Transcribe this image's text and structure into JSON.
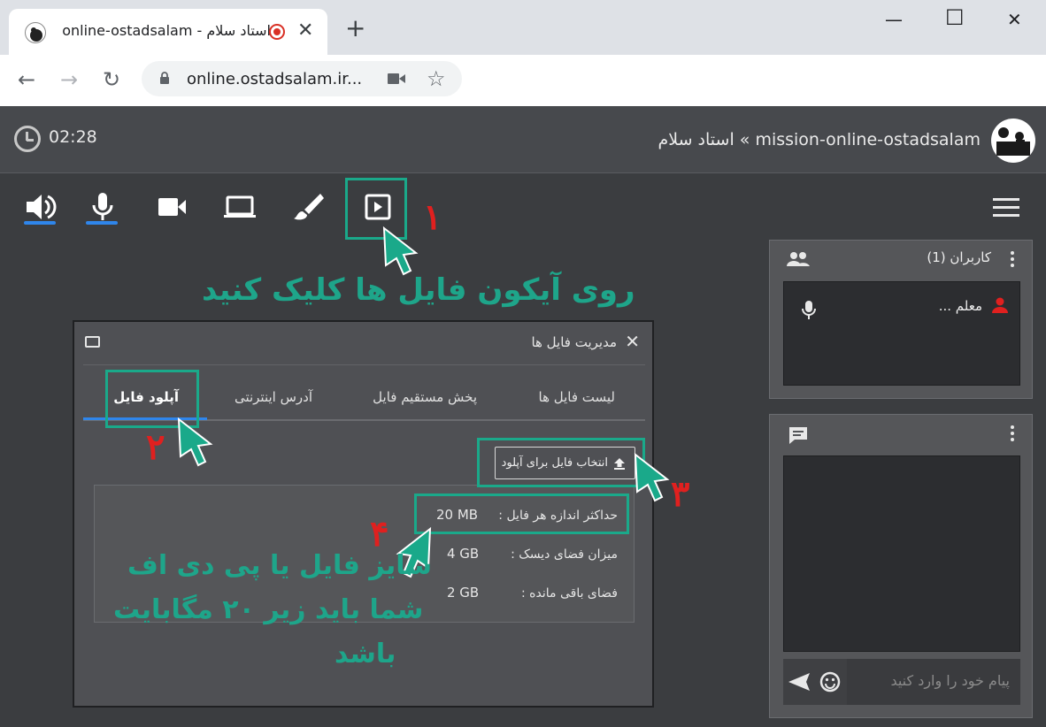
{
  "browser": {
    "tab_title": "استاد سلام - online-ostadsalam",
    "tab_close": "✕",
    "new_tab": "+",
    "minimize": "—",
    "maximize": "☐",
    "close": "✕",
    "back": "←",
    "forward": "→",
    "reload": "↻",
    "url": "online.ostadsalam.ir...",
    "star": "☆"
  },
  "header": {
    "timer": "02:28",
    "room_title": "استاد سلام « mission-online-ostadsalam"
  },
  "toolbar": {
    "icons": [
      "speaker-icon",
      "microphone-icon",
      "camera-icon",
      "screen-share-icon",
      "whiteboard-brush-icon",
      "file-presentation-icon",
      "menu-icon"
    ]
  },
  "annotations": {
    "step1_num": "۱",
    "step1_text": "روی آیکون فایل ها کلیک کنید",
    "step2_num": "۲",
    "step3_num": "۳",
    "step4_num": "۴",
    "step4_line1": "سایز فایل یا پی دی اف",
    "step4_line2": "شما باید زیر ۲۰ مگابایت",
    "step4_line3": "باشد",
    "color": "#1ea58a",
    "number_color": "#e0201f"
  },
  "users_panel": {
    "title": "کاربران (1)",
    "user_name": "معلم ..."
  },
  "chat_panel": {
    "input_placeholder": "پیام خود را وارد کنید"
  },
  "file_manager": {
    "title": "مدیریت فایل ها",
    "tabs": [
      "لیست فایل ها",
      "پخش مستقیم فایل",
      "آدرس اینترنتی",
      "آپلود فایل"
    ],
    "active_tab": "آپلود فایل",
    "upload_button": "انتخاب فایل برای آپلود",
    "info": [
      {
        "label": "حداکثر اندازه هر فایل :",
        "value": "20 MB"
      },
      {
        "label": "میزان فضای دیسک :",
        "value": "4 GB"
      },
      {
        "label": "فضای باقی مانده :",
        "value": "2 GB"
      }
    ]
  },
  "colors": {
    "accent_blue": "#2f86eb",
    "user_red": "#e0201f",
    "annotation_green": "#1aa98a"
  }
}
